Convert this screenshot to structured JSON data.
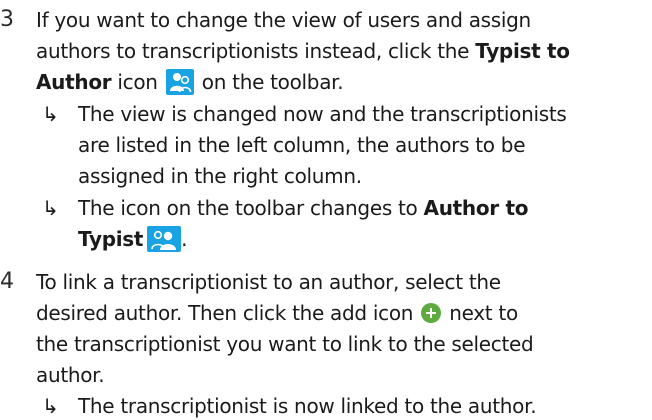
{
  "steps": [
    {
      "number": "3",
      "lines": [
        "If you want to change the view of users and assign",
        "authors to transcriptionists instead, click the ",
        "Typist to",
        "Author",
        " icon ",
        " on the toolbar."
      ],
      "results": [
        {
          "lines": [
            "The view is changed now and the transcriptionists",
            "are listed in the left column, the authors to be",
            "assigned in the right column."
          ]
        },
        {
          "lines": [
            "The icon on the toolbar changes to ",
            "Author to",
            "Typist",
            "."
          ]
        }
      ]
    },
    {
      "number": "4",
      "lines": [
        "To link a transcriptionist to an author, select the",
        "desired author. Then click the add icon ",
        " next to",
        "the transcriptionist you want to link to the selected",
        "author."
      ],
      "results": [
        {
          "lines": [
            "The transcriptionist is now linked to the author."
          ]
        }
      ]
    }
  ],
  "arrow_glyph": "↳",
  "icons": {
    "typist_to_author": "typist-to-author-icon",
    "author_to_typist": "author-to-typist-icon",
    "add": "add-icon"
  },
  "colors": {
    "icon_blue": "#1aa3e3",
    "add_green": "#5dab3f",
    "text": "#1b1b1b"
  }
}
